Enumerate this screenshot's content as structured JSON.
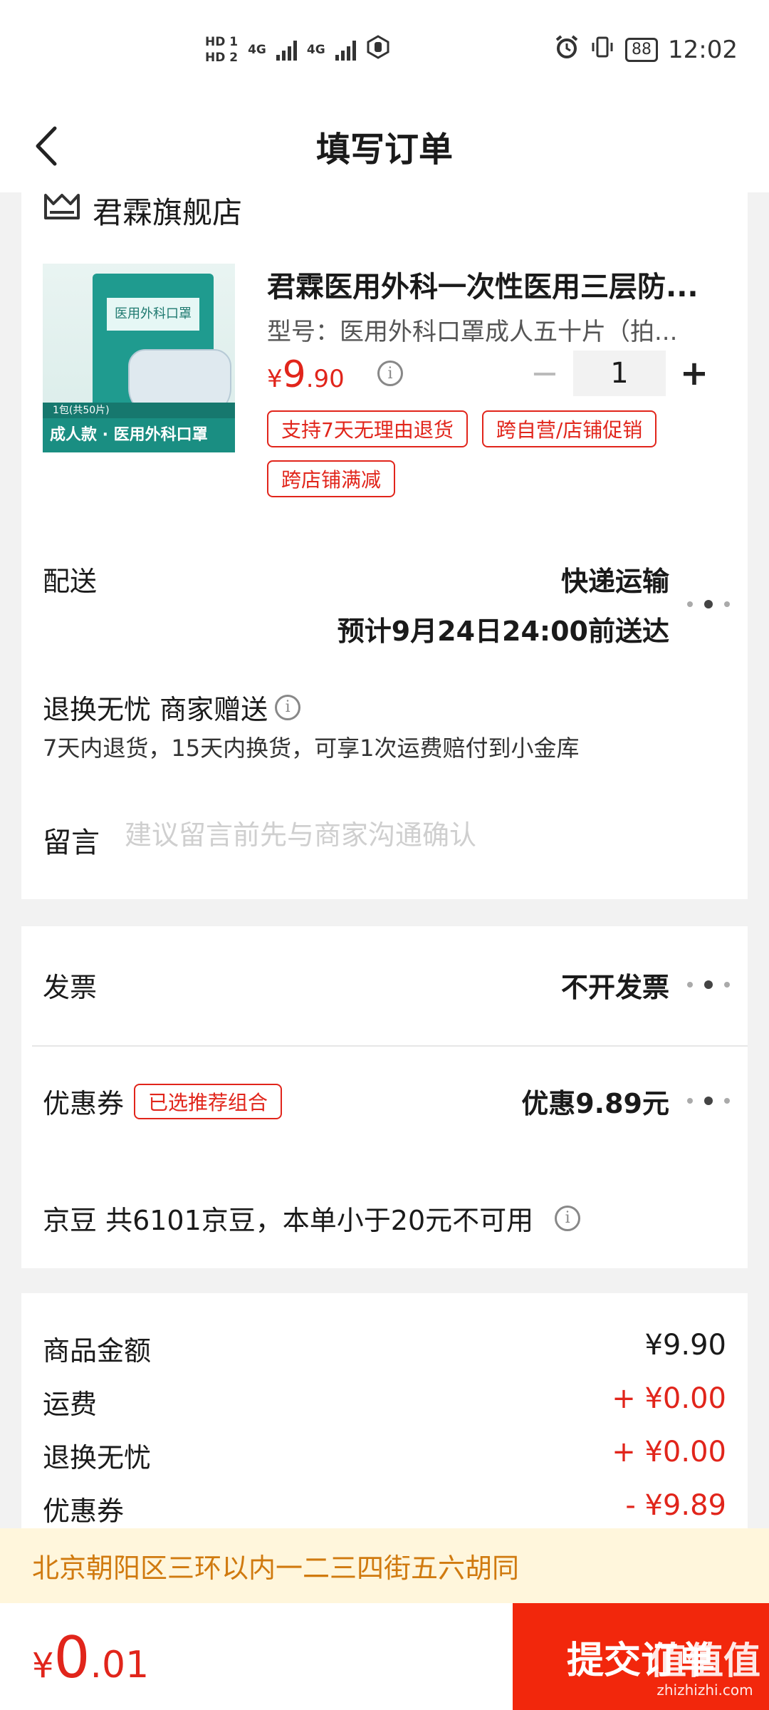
{
  "status_bar": {
    "sim1": "HD 1",
    "sim2": "HD 2",
    "net1": "4G",
    "net2": "4G",
    "battery": "88",
    "time": "12:02"
  },
  "nav": {
    "title": "填写订单"
  },
  "store": {
    "name": "君霖旗舰店"
  },
  "product": {
    "title": "君霖医用外科一次性医用三层防...",
    "spec": "型号：医用外科口罩成人五十片（拍...",
    "price_symbol": "¥",
    "price_int": "9",
    "price_dec": ".90",
    "quantity": "1",
    "image": {
      "pack_label": "医用外科口罩",
      "count_label": "1包(共50片)",
      "band_label": "成人款 · 医用外科口罩"
    },
    "tags": [
      "支持7天无理由退货",
      "跨自营/店铺促销",
      "跨店铺满减"
    ]
  },
  "delivery": {
    "label": "配送",
    "method": "快递运输",
    "eta": "预计9月24日24:00前送达"
  },
  "service": {
    "title": "退换无忧 商家赠送",
    "desc": "7天内退货，15天内换货，可享1次运费赔付到小金库"
  },
  "message": {
    "label": "留言",
    "placeholder": "建议留言前先与商家沟通确认"
  },
  "invoice": {
    "label": "发票",
    "value": "不开发票"
  },
  "coupon": {
    "label": "优惠券",
    "badge": "已选推荐组合",
    "value": "优惠9.89元"
  },
  "jingdou": {
    "text": "京豆 共6101京豆，本单小于20元不可用"
  },
  "summary": [
    {
      "label": "商品金额",
      "value": "¥9.90",
      "color": "#1a1a1a"
    },
    {
      "label": "运费",
      "value": "+ ¥0.00",
      "color": "#e1251b"
    },
    {
      "label": "退换无忧",
      "value": "+ ¥0.00",
      "color": "#e1251b"
    },
    {
      "label": "优惠券",
      "value": "- ¥9.89",
      "color": "#e1251b"
    }
  ],
  "address": "北京朝阳区三环以内一二三四街五六胡同",
  "total": {
    "symbol": "¥",
    "int": "0",
    "dec": ".01"
  },
  "submit_label": "提交订单",
  "watermark": {
    "main": "值值值",
    "sub": "zhizhizhi.com"
  },
  "colors": {
    "accent": "#e1251b",
    "submit": "#f2270c",
    "address_bg": "#fff6dc",
    "address_text": "#d07a0f"
  }
}
